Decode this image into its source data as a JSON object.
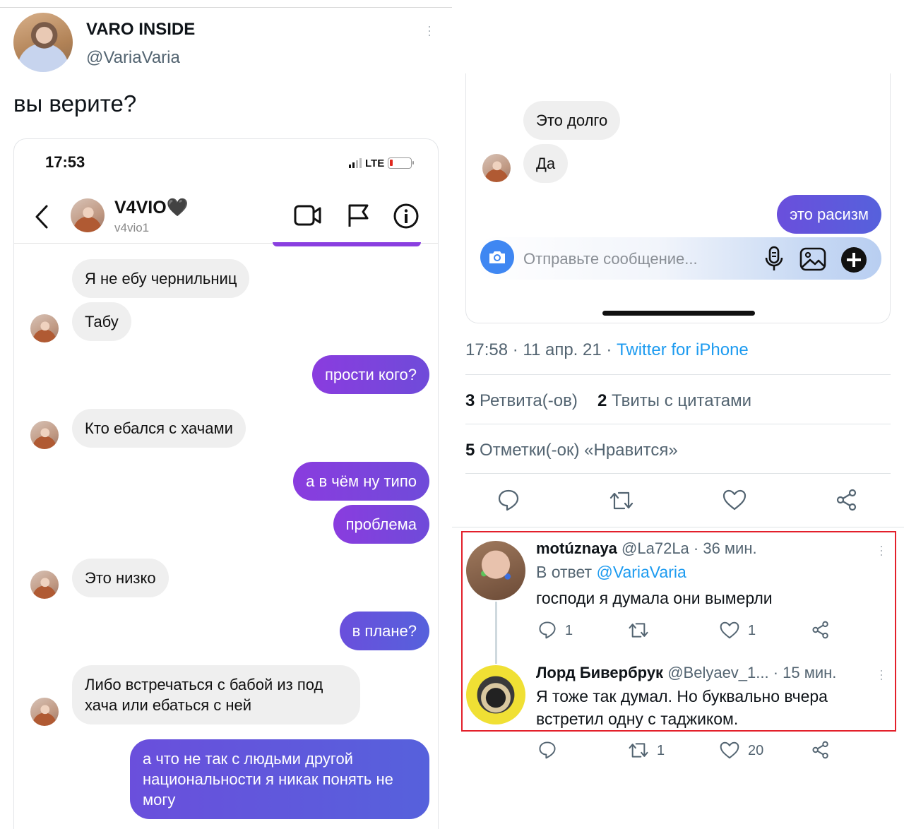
{
  "tweet": {
    "author_name": "VARO INSIDE",
    "author_handle": "@VariaVaria",
    "text": "вы верите?"
  },
  "phone": {
    "time": "17:53",
    "network": "LTE",
    "contact_name": "V4VIO🖤",
    "contact_user": "v4vio1",
    "messages": [
      {
        "text": "Я не ебу чернильниц"
      },
      {
        "text": "Табу"
      },
      {
        "text": "прости кого?"
      },
      {
        "text": "Кто ебался с хачами"
      },
      {
        "text": "а в чём ну типо"
      },
      {
        "text": "проблема"
      },
      {
        "text": "Это низко"
      },
      {
        "text": "в плане?"
      },
      {
        "text": "Либо встречаться с бабой из под хача или ебаться с ней"
      },
      {
        "text": "а что не так с людьми другой национальности я никак понять не могу"
      }
    ]
  },
  "phone2": {
    "messages": [
      {
        "text": "Это долго"
      },
      {
        "text": "Да"
      },
      {
        "text": "это расизм"
      }
    ],
    "compose_placeholder": "Отправьте сообщение..."
  },
  "details": {
    "time": "17:58 · 11 апр. 21 · ",
    "source": "Twitter for iPhone",
    "retweets_count": "3",
    "retweets_label": "Ретвита(-ов)",
    "quotes_count": "2",
    "quotes_label": "Твиты с цитатами",
    "likes_count": "5",
    "likes_label": "Отметки(-ок) «Нравится»"
  },
  "replies": [
    {
      "name": "motúznaya",
      "handle_time": "@La72La · 36 мин.",
      "reply_prefix": "В ответ ",
      "reply_to": "@VariaVaria",
      "text": "господи я думала они вымерли",
      "reply_count": "1",
      "like_count": "1"
    },
    {
      "name": "Лорд Бивербрук",
      "handle_time": "@Belyaev_1... · 15 мин.",
      "text": "Я тоже так думал. Но буквально вчера встретил одну с таджиком.",
      "retweet_count": "1",
      "like_count": "20"
    }
  ],
  "colors": {
    "twitter_blue": "#1d9bf0",
    "bubble_purple": "#8a3cdf",
    "bubble_blue": "#5661dc",
    "highlight_red": "#e3202b"
  }
}
